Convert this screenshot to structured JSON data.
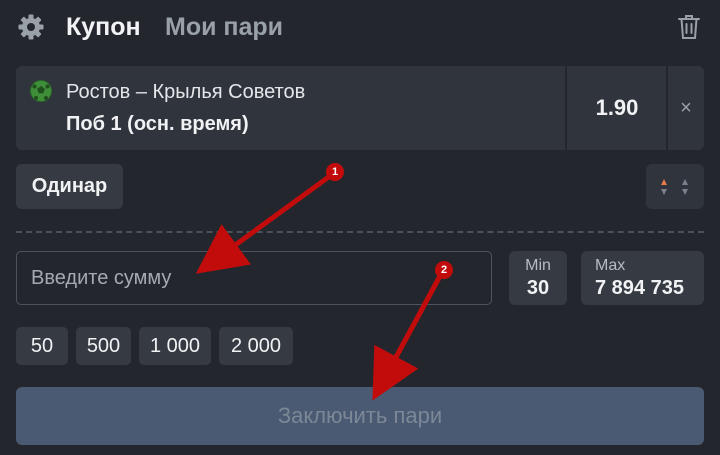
{
  "header": {
    "tab_active": "Купон",
    "tab_other": "Мои пари"
  },
  "bet": {
    "match": "Ростов – Крылья Советов",
    "market": "Поб 1 (осн. время)",
    "odds": "1.90",
    "close_symbol": "×"
  },
  "bet_type": {
    "label": "Одинар"
  },
  "stake": {
    "placeholder": "Введите сумму",
    "min_label": "Min",
    "min_value": "30",
    "max_label": "Max",
    "max_value": "7 894 735"
  },
  "quick_amounts": [
    "50",
    "500",
    "1 000",
    "2 000"
  ],
  "submit_label": "Заключить пари",
  "annotations": [
    "1",
    "2"
  ],
  "colors": {
    "background": "#23272d",
    "card": "#30353d",
    "button": "#363b43",
    "submit": "#4a5a72",
    "annotation": "#c20c0c",
    "sort_up": "#e8784a"
  }
}
